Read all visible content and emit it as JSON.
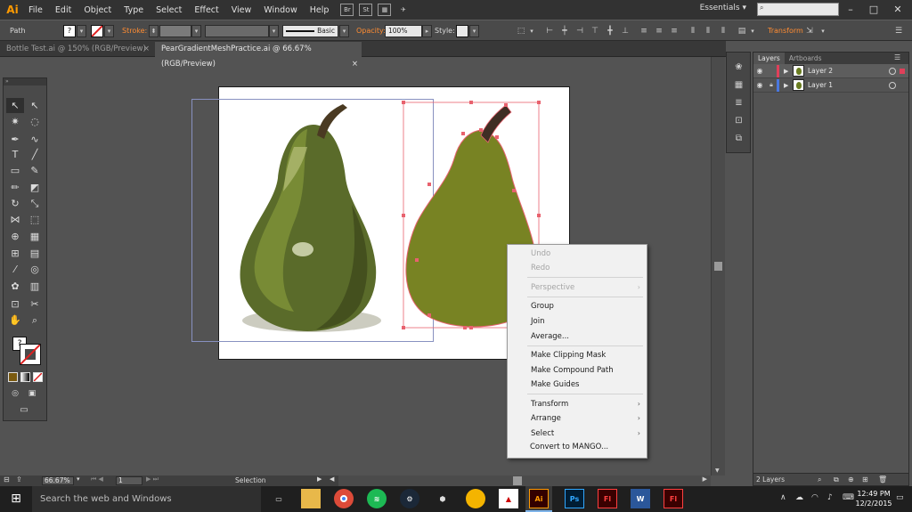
{
  "app": {
    "logo": "Ai",
    "colors": {
      "accent": "#ff9a00",
      "chrome_dark": "#323232",
      "canvas_bg": "#535353"
    }
  },
  "menubar": {
    "items": [
      "File",
      "Edit",
      "Object",
      "Type",
      "Select",
      "Effect",
      "View",
      "Window",
      "Help"
    ],
    "bridge": "Br",
    "stock": "St",
    "workspace": "Essentials",
    "window_controls": [
      "–",
      "□",
      "✕"
    ]
  },
  "control_bar": {
    "selection_type": "Path",
    "stroke_label": "Stroke:",
    "brush_label": "Basic",
    "opacity_label": "Opacity:",
    "opacity_value": "100%",
    "style_label": "Style:",
    "transform_label": "Transform"
  },
  "tabs": [
    {
      "label": "Bottle Test.ai @ 150% (RGB/Preview)",
      "active": false
    },
    {
      "label": "PearGradientMeshPractice.ai @ 66.67% (RGB/Preview)",
      "active": true
    }
  ],
  "tab_close": "×",
  "toolbox": {
    "tools": [
      "selection-arrow-icon",
      "direct-selection-icon",
      "magic-wand-icon",
      "lasso-icon",
      "pen-icon",
      "curvature-icon",
      "type-icon",
      "line-icon",
      "rectangle-icon",
      "paintbrush-icon",
      "pencil-icon",
      "eraser-icon",
      "rotate-icon",
      "scale-icon",
      "width-icon",
      "free-transform-icon",
      "shape-builder-icon",
      "perspective-grid-icon",
      "mesh-icon",
      "gradient-icon",
      "eyedropper-icon",
      "blend-icon",
      "symbol-sprayer-icon",
      "column-graph-icon",
      "artboard-icon",
      "slice-icon",
      "hand-icon",
      "zoom-icon"
    ],
    "fill_stroke_unknown": "?"
  },
  "context_menu": {
    "items": [
      {
        "label": "Undo",
        "disabled": true,
        "submenu": false
      },
      {
        "label": "Redo",
        "disabled": true,
        "submenu": false
      },
      {
        "label": "Perspective",
        "disabled": true,
        "submenu": true
      },
      {
        "label": "Group",
        "disabled": false,
        "submenu": false
      },
      {
        "label": "Join",
        "disabled": false,
        "submenu": false
      },
      {
        "label": "Average...",
        "disabled": false,
        "submenu": false
      },
      {
        "label": "Make Clipping Mask",
        "disabled": false,
        "submenu": false
      },
      {
        "label": "Make Compound Path",
        "disabled": false,
        "submenu": false
      },
      {
        "label": "Make Guides",
        "disabled": false,
        "submenu": false
      },
      {
        "label": "Transform",
        "disabled": false,
        "submenu": true
      },
      {
        "label": "Arrange",
        "disabled": false,
        "submenu": true
      },
      {
        "label": "Select",
        "disabled": false,
        "submenu": true
      },
      {
        "label": "Convert to MANGO...",
        "disabled": false,
        "submenu": false
      }
    ]
  },
  "layers_panel": {
    "tabs": [
      "Layers",
      "Artboards"
    ],
    "layers": [
      {
        "name": "Layer 2",
        "color": "#e0405a",
        "selected": true,
        "locked": false
      },
      {
        "name": "Layer 1",
        "color": "#4a78e0",
        "selected": false,
        "locked": true
      }
    ],
    "footer": "2 Layers"
  },
  "status_bar": {
    "zoom": "66.67%",
    "artboard": "1",
    "tool": "Selection"
  },
  "taskbar": {
    "search_placeholder": "Search the web and Windows",
    "apps": [
      "Ps",
      "Fl",
      "W",
      "Fl"
    ],
    "time": "12:49 PM",
    "date": "12/2/2015"
  }
}
